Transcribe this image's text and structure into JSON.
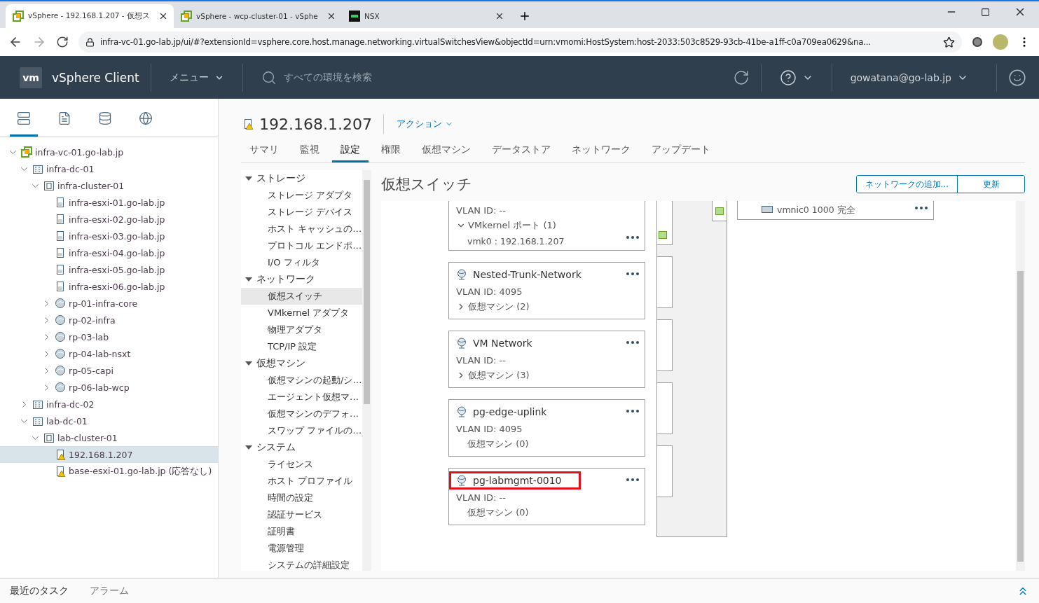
{
  "browser": {
    "tabs": [
      {
        "title": "vSphere - 192.168.1.207 - 仮想ス",
        "kind": "vsphere",
        "selected": true
      },
      {
        "title": "vSphere - wcp-cluster-01 - vSphe",
        "kind": "vsphere",
        "selected": false
      },
      {
        "title": "NSX",
        "kind": "nsx",
        "selected": false
      }
    ],
    "url": "infra-vc-01.go-lab.jp/ui/#?extensionId=vsphere.core.host.manage.networking.virtualSwitchesView&objectId=urn:vmomi:HostSystem:host-2033:503c8529-93cb-41be-a1ff-c0a709ea0629&na..."
  },
  "header": {
    "logo": "vm",
    "product": "vSphere Client",
    "menu": "メニュー",
    "search_placeholder": "すべての環境を検索",
    "user": "gowatana@go-lab.jp"
  },
  "navigator": {
    "tabs": [
      {
        "kind": "hosts",
        "selected": true
      },
      {
        "kind": "vms",
        "selected": false
      },
      {
        "kind": "storage",
        "selected": false
      },
      {
        "kind": "network",
        "selected": false
      }
    ],
    "tree": [
      {
        "label": "infra-vc-01.go-lab.jp",
        "kind": "vcenter",
        "expanded": true,
        "selected": false,
        "children": [
          {
            "label": "infra-dc-01",
            "kind": "datacenter",
            "expanded": true,
            "selected": false,
            "children": [
              {
                "label": "infra-cluster-01",
                "kind": "cluster",
                "expanded": true,
                "selected": false,
                "children": [
                  {
                    "label": "infra-esxi-01.go-lab.jp",
                    "kind": "host",
                    "selected": false
                  },
                  {
                    "label": "infra-esxi-02.go-lab.jp",
                    "kind": "host",
                    "selected": false
                  },
                  {
                    "label": "infra-esxi-03.go-lab.jp",
                    "kind": "host",
                    "selected": false
                  },
                  {
                    "label": "infra-esxi-04.go-lab.jp",
                    "kind": "host",
                    "selected": false
                  },
                  {
                    "label": "infra-esxi-05.go-lab.jp",
                    "kind": "host",
                    "selected": false
                  },
                  {
                    "label": "infra-esxi-06.go-lab.jp",
                    "kind": "host",
                    "selected": false
                  },
                  {
                    "label": "rp-01-infra-core",
                    "kind": "pool",
                    "expanded": false,
                    "selected": false
                  },
                  {
                    "label": "rp-02-infra",
                    "kind": "pool",
                    "expanded": false,
                    "selected": false
                  },
                  {
                    "label": "rp-03-lab",
                    "kind": "pool",
                    "expanded": false,
                    "selected": false
                  },
                  {
                    "label": "rp-04-lab-nsxt",
                    "kind": "pool",
                    "expanded": false,
                    "selected": false
                  },
                  {
                    "label": "rp-05-capi",
                    "kind": "pool",
                    "expanded": false,
                    "selected": false
                  },
                  {
                    "label": "rp-06-lab-wcp",
                    "kind": "pool",
                    "expanded": false,
                    "selected": false
                  }
                ]
              }
            ]
          },
          {
            "label": "infra-dc-02",
            "kind": "datacenter",
            "expanded": false,
            "selected": false
          },
          {
            "label": "lab-dc-01",
            "kind": "datacenter",
            "expanded": true,
            "selected": false,
            "children": [
              {
                "label": "lab-cluster-01",
                "kind": "cluster",
                "expanded": true,
                "selected": false,
                "children": [
                  {
                    "label": "192.168.1.207",
                    "kind": "host-alert",
                    "selected": true
                  },
                  {
                    "label": "base-esxi-01.go-lab.jp (応答なし)",
                    "kind": "host-alert",
                    "selected": false
                  }
                ]
              }
            ]
          }
        ]
      }
    ]
  },
  "object": {
    "title": "192.168.1.207",
    "actions": "アクション",
    "tabs": [
      {
        "label": "サマリ",
        "selected": false
      },
      {
        "label": "監視",
        "selected": false
      },
      {
        "label": "設定",
        "selected": true
      },
      {
        "label": "権限",
        "selected": false
      },
      {
        "label": "仮想マシン",
        "selected": false
      },
      {
        "label": "データストア",
        "selected": false
      },
      {
        "label": "ネットワーク",
        "selected": false
      },
      {
        "label": "アップデート",
        "selected": false
      }
    ]
  },
  "settings_nav": [
    {
      "label": "ストレージ",
      "expanded": true,
      "items": [
        {
          "label": "ストレージ アダプタ",
          "selected": false
        },
        {
          "label": "ストレージ デバイス",
          "selected": false
        },
        {
          "label": "ホスト キャッシュの…",
          "selected": false
        },
        {
          "label": "プロトコル エンドポ…",
          "selected": false
        },
        {
          "label": "I/O フィルタ",
          "selected": false
        }
      ]
    },
    {
      "label": "ネットワーク",
      "expanded": true,
      "items": [
        {
          "label": "仮想スイッチ",
          "selected": true
        },
        {
          "label": "VMkernel アダプタ",
          "selected": false
        },
        {
          "label": "物理アダプタ",
          "selected": false
        },
        {
          "label": "TCP/IP 設定",
          "selected": false
        }
      ]
    },
    {
      "label": "仮想マシン",
      "expanded": true,
      "items": [
        {
          "label": "仮想マシンの起動/シ…",
          "selected": false
        },
        {
          "label": "エージェント仮想マ…",
          "selected": false
        },
        {
          "label": "仮想マシンのデフォ…",
          "selected": false
        },
        {
          "label": "スワップ ファイルの…",
          "selected": false
        }
      ]
    },
    {
      "label": "システム",
      "expanded": true,
      "items": [
        {
          "label": "ライセンス",
          "selected": false
        },
        {
          "label": "ホスト プロファイル",
          "selected": false
        },
        {
          "label": "時間の設定",
          "selected": false
        },
        {
          "label": "認証サービス",
          "selected": false
        },
        {
          "label": "証明書",
          "selected": false
        },
        {
          "label": "電源管理",
          "selected": false
        },
        {
          "label": "システムの詳細設定",
          "selected": false
        }
      ]
    }
  ],
  "switch_view": {
    "heading": "仮想スイッチ",
    "buttons": [
      "ネットワークの追加...",
      "更新"
    ],
    "port_groups": [
      {
        "kind": "partial",
        "vlan": "VLAN ID: --",
        "members": "VMkernel ポート (1)",
        "expanded": true,
        "detail": "vmk0 : 192.168.1.207"
      },
      {
        "kind": "full",
        "name": "Nested-Trunk-Network",
        "vlan": "VLAN ID: 4095",
        "members": "仮想マシン (2)",
        "expanded": false,
        "highlighted": false
      },
      {
        "kind": "full",
        "name": "VM Network",
        "vlan": "VLAN ID: --",
        "members": "仮想マシン (3)",
        "expanded": false,
        "highlighted": false
      },
      {
        "kind": "empty",
        "name": "pg-edge-uplink",
        "vlan": "VLAN ID: 4095",
        "members": "仮想マシン (0)",
        "highlighted": false
      },
      {
        "kind": "empty",
        "name": "pg-labmgmt-0010",
        "vlan": "VLAN ID: --",
        "members": "仮想マシン (0)",
        "highlighted": true
      }
    ],
    "uplink": "vmnic0 1000 完全"
  },
  "bottom_bar": {
    "tabs": [
      "最近のタスク",
      "アラーム"
    ]
  }
}
